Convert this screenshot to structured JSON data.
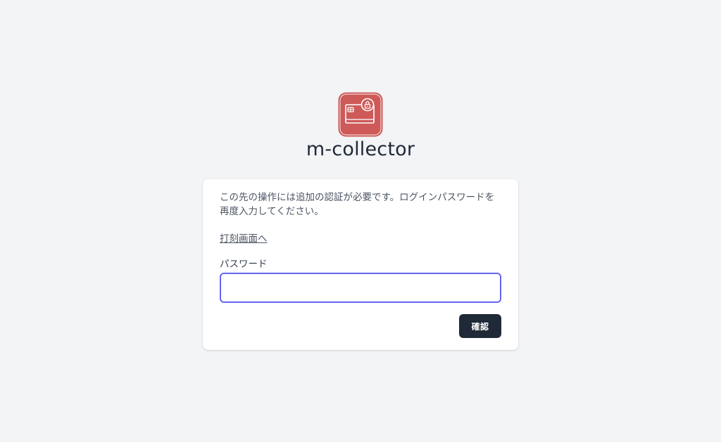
{
  "app": {
    "name": "m-collector",
    "logo_icon": "credit-card-lock-icon",
    "logo_color": "#cd5a58"
  },
  "card": {
    "message": "この先の操作には追加の認証が必要です。ログインパスワードを再度入力してください。",
    "link_label": "打刻画面へ",
    "password_label": "パスワード",
    "password_value": "",
    "password_placeholder": "",
    "confirm_label": "確認"
  },
  "colors": {
    "background": "#f3f4f6",
    "input_focus_border": "#6366f1",
    "button_bg": "#1f2937"
  }
}
